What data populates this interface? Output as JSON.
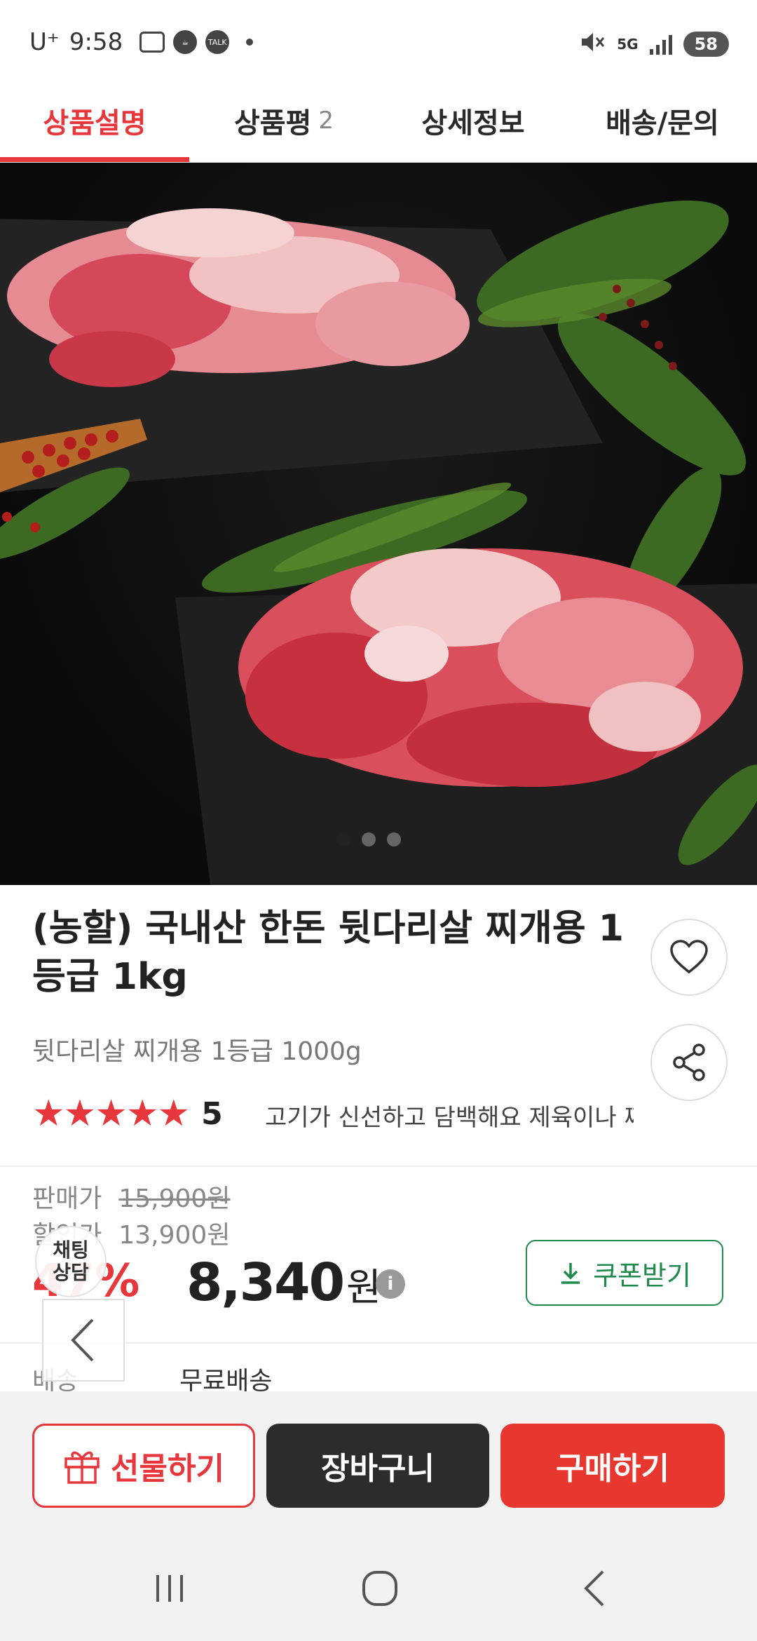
{
  "status_bar": {
    "carrier": "U⁺",
    "time": "9:58",
    "network": "5G",
    "battery": "58"
  },
  "tabs": [
    {
      "label": "상품설명",
      "count": ""
    },
    {
      "label": "상품평",
      "count": "2"
    },
    {
      "label": "상세정보",
      "count": ""
    },
    {
      "label": "배송/문의",
      "count": ""
    }
  ],
  "product": {
    "title": "(농할) 국내산 한돈 뒷다리살 찌개용 1등급 1kg",
    "subtitle": "뒷다리살 찌개용 1등급 1000g",
    "rating": "5",
    "stars": "★★★★★",
    "review_preview": "고기가 신선하고 담백해요 제육이나 찌개",
    "price_label": "판매가",
    "original_price": "15,900원",
    "sale_label": "할인가",
    "sale_price": "13,900원",
    "discount": "47%",
    "final_price": "8,340",
    "final_unit": "원",
    "info_symbol": "i",
    "coupon_label": "쿠폰받기",
    "shipping_label": "배송",
    "shipping_value": "무료배송"
  },
  "chat_label": "채팅\n상담",
  "actions": {
    "gift": "선물하기",
    "cart": "장바구니",
    "buy": "구매하기"
  },
  "colors": {
    "accent": "#e8373c",
    "coupon": "#1f8a4c",
    "dark_button": "#2c2c2c"
  }
}
